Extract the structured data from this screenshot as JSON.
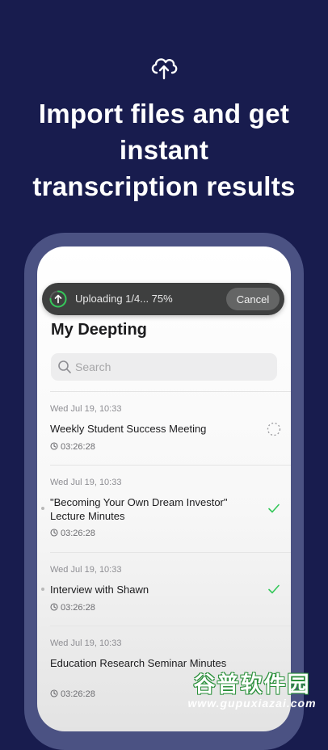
{
  "hero": {
    "icon": "cloud-upload-icon",
    "title_lines": [
      "Import files and get",
      "instant",
      "transcription results"
    ]
  },
  "upload": {
    "status_text": "Uploading 1/4... 75%",
    "progress": 0.75,
    "cancel_label": "Cancel"
  },
  "app": {
    "page_title": "My Deepting",
    "search_placeholder": "Search"
  },
  "list": [
    {
      "date": "Wed Jul 19, 10:33",
      "title": "Weekly Student Success Meeting",
      "duration": "03:26:28",
      "status": "processing"
    },
    {
      "date": "Wed Jul 19, 10:33",
      "title": "\"Becoming Your Own Dream Investor\" Lecture Minutes",
      "duration": "03:26:28",
      "status": "done"
    },
    {
      "date": "Wed Jul 19, 10:33",
      "title": "Interview with Shawn",
      "duration": "03:26:28",
      "status": "done"
    },
    {
      "date": "Wed Jul 19, 10:33",
      "title": "Education Research Seminar Minutes",
      "duration": "03:26:28",
      "status": "none"
    }
  ],
  "watermark": {
    "brand": "谷普软件园",
    "url": "www.gupuxiazai.com"
  },
  "colors": {
    "background": "#181c4e",
    "accent_green": "#34c759"
  }
}
